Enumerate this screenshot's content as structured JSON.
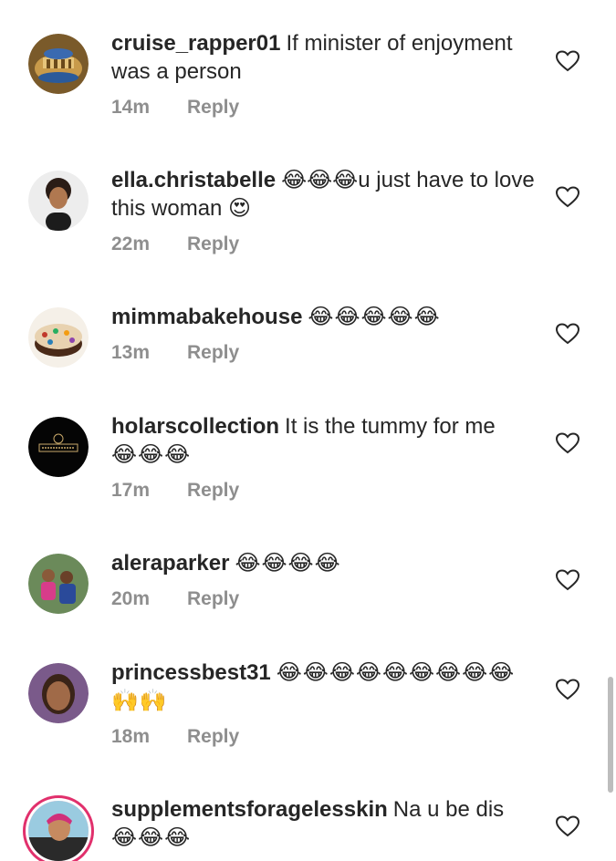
{
  "comments": [
    {
      "username": "cruise_rapper01",
      "text": "If minister of enjoyment was a person",
      "emojis": "",
      "time": "14m",
      "reply": "Reply",
      "avatar_icon": "architecture-icon"
    },
    {
      "username": "ella.christabelle",
      "text": "😂😂😂u just have to love this woman 😍",
      "emojis": "",
      "time": "22m",
      "reply": "Reply",
      "avatar_icon": "woman-portrait-icon"
    },
    {
      "username": "mimmabakehouse",
      "text": "",
      "emojis": "😂😂😂😂😂",
      "time": "13m",
      "reply": "Reply",
      "avatar_icon": "cake-icon"
    },
    {
      "username": "holarscollection",
      "text": "It is the tummy for me",
      "emojis": "😂😂😂",
      "time": "17m",
      "reply": "Reply",
      "avatar_icon": "brand-logo-icon"
    },
    {
      "username": "aleraparker",
      "text": "",
      "emojis": "😂😂😂😂",
      "time": "20m",
      "reply": "Reply",
      "avatar_icon": "family-photo-icon"
    },
    {
      "username": "princessbest31",
      "text": "",
      "emojis": "😂😂😂😂😂😂😂😂😂🙌🙌",
      "time": "18m",
      "reply": "Reply",
      "avatar_icon": "woman-portrait-icon"
    },
    {
      "username": "supplementsforagelesskin",
      "text": "Na u be dis",
      "emojis": "😂😂😂",
      "time": "",
      "reply": "",
      "avatar_icon": "woman-portrait-icon"
    }
  ],
  "colors": {
    "text": "#262626",
    "meta": "#8e8e8e",
    "story_ring": "#e1306c"
  },
  "icons": {
    "like": "heart-outline-icon"
  }
}
